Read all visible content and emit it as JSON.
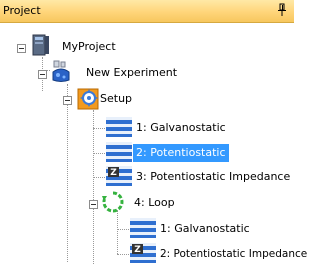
{
  "panel": {
    "title": "Project",
    "pin_icon": "pin-icon"
  },
  "tree": {
    "root": {
      "label": "MyProject",
      "icon": "computer-icon"
    },
    "experiment": {
      "label": "New Experiment",
      "icon": "flask-icon"
    },
    "setup": {
      "label": "Setup",
      "icon": "gear-icon"
    },
    "steps": [
      {
        "label": "1: Galvanostatic",
        "icon": "step-icon"
      },
      {
        "label": "2: Potentiostatic",
        "icon": "step-icon",
        "selected": true
      },
      {
        "label": "3: Potentiostatic Impedance",
        "icon": "impedance-step-icon"
      }
    ],
    "loop": {
      "label": "4: Loop",
      "icon": "loop-icon",
      "children": [
        {
          "label": "1: Galvanostatic",
          "icon": "step-icon"
        },
        {
          "label": "2: Potentiostatic Impedance",
          "icon": "impedance-step-icon"
        }
      ]
    }
  },
  "colors": {
    "selection": "#3399ff",
    "titlebar": "#ffd57a"
  }
}
